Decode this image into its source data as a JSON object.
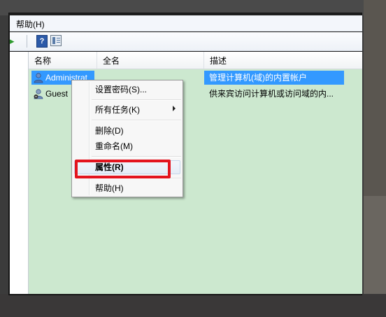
{
  "menubar": {
    "help_label": "帮助(H)"
  },
  "toolbar": {
    "back_icon": "arrow-right-icon",
    "help_icon": "help-icon",
    "help_glyph": "?",
    "pane_icon": "show-hide-pane-icon"
  },
  "list": {
    "columns": [
      "名称",
      "全名",
      "描述"
    ],
    "rows": [
      {
        "name": "Administrat",
        "full_name": "",
        "description": "管理计算机(域)的内置帐户",
        "selected": true
      },
      {
        "name": "Guest",
        "full_name": "",
        "description": "供来宾访问计算机或访问域的内...",
        "selected": false
      }
    ]
  },
  "context_menu": {
    "items": [
      "设置密码(S)...",
      "所有任务(K)",
      "删除(D)",
      "重命名(M)",
      "属性(R)",
      "帮助(H)"
    ],
    "highlighted_item": "属性(R)"
  },
  "colors": {
    "selection": "#3399ff",
    "list_background": "#cce8cf",
    "highlight_box": "#e3141e"
  }
}
